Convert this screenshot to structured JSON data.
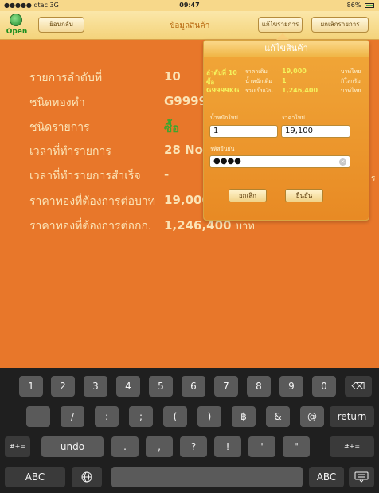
{
  "status": {
    "carrier": "●●●●● dtac  3G",
    "time": "09:47",
    "battery": "86%"
  },
  "nav": {
    "open_label": "Open",
    "back_label": "ย้อนกลับ",
    "title": "ข้อมูลสินค้า",
    "edit_label": "แก้ไขรายการ",
    "cancel_order_label": "ยกเลิกรายการ"
  },
  "details": [
    {
      "label": "รายการลำดับที่",
      "value": "10"
    },
    {
      "label": "ชนิดทองคำ",
      "value": "G9999"
    },
    {
      "label": "ชนิดรายการ",
      "value": "ซื้อ"
    },
    {
      "label": "เวลาที่ทำรายการ",
      "value": "28 Nov"
    },
    {
      "label": "เวลาที่ทำรายการสำเร็จ",
      "value": "-"
    },
    {
      "label": "ราคาทองที่ต้องการต่อบาท",
      "value": "19,000"
    },
    {
      "label": "ราคาทองที่ต้องการต่อกก.",
      "value": "1,246,400",
      "unit": "บาท"
    }
  ],
  "popover": {
    "title": "แก้ไขสินค้า",
    "order_label": "ลำดับที่ 10",
    "price_old_label": "ราคาเดิม",
    "price_old_value": "19,000",
    "price_old_unit": "บาทไทย",
    "type_value": "ซื้อ",
    "weight_old_label": "น้ำหนักเดิม",
    "weight_old_value": "1",
    "weight_old_unit": "กิโลกรัม",
    "product_value": "G9999KG",
    "total_label": "รวมเป็นเงิน",
    "total_value": "1,246,400",
    "total_unit": "บาทไทย",
    "new_weight_label": "น้ำหนักใหม่",
    "new_weight_value": "1",
    "new_price_label": "ราคาใหม่",
    "new_price_value": "19,100",
    "pin_label": "รหัสยืนยัน",
    "pin_value": "●●●●",
    "cancel_button": "ยกเลิก",
    "confirm_button": "ยืนยัน",
    "trailing_char": "ร"
  },
  "keyboard": {
    "row1": [
      "1",
      "2",
      "3",
      "4",
      "5",
      "6",
      "7",
      "8",
      "9",
      "0",
      "⌫"
    ],
    "row2": [
      "-",
      "/",
      ":",
      ";",
      "(",
      ")",
      "฿",
      "&",
      "@",
      "return"
    ],
    "row3": [
      "#+=",
      "undo",
      ".",
      ",",
      "?",
      "!",
      "'",
      "\"",
      "#+="
    ],
    "row4": [
      "ABC",
      "globe",
      "",
      "ABC",
      "hide"
    ]
  }
}
